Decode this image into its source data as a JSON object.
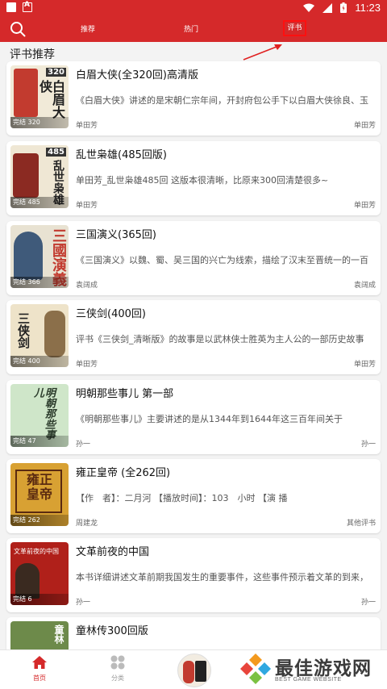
{
  "statusbar": {
    "time": "11:23"
  },
  "tabs": {
    "recommend": "推荐",
    "hot": "热门",
    "review": "评书"
  },
  "section": {
    "title": "评书推荐"
  },
  "books": [
    {
      "badge": "完结 320",
      "title": "白眉大侠(全320回)高清版",
      "desc": "《白眉大侠》讲述的是宋朝仁宗年间，开封府包公手下以白眉大侠徐良、玉",
      "author": "单田芳",
      "right": "单田芳",
      "cover_color": "#c23b2f",
      "cover_text": "白眉大侠",
      "cover_tag": "320"
    },
    {
      "badge": "完结 485",
      "title": "乱世枭雄(485回版)",
      "desc": "单田芳_乱世枭雄485回 这版本很清晰，比原来300回清楚很多~",
      "author": "单田芳",
      "right": "单田芳",
      "cover_color": "#8b2a22",
      "cover_text": "乱世枭雄",
      "cover_tag": "485"
    },
    {
      "badge": "完结 366",
      "title": "三国演义(365回)",
      "desc": "《三国演义》以魏、蜀、吴三国的兴亡为线索，描绘了汉末至晋统一的一百",
      "author": "袁阔成",
      "right": "袁阔成",
      "cover_color": "#3f5a7a",
      "cover_text": "三國演義",
      "cover_tag": ""
    },
    {
      "badge": "完结 400",
      "title": "三侠剑(400回)",
      "desc": "评书《三侠剑_清晰版》的故事是以武林侠士胜英为主人公的一部历史故事",
      "author": "单田芳",
      "right": "单田芳",
      "cover_color": "#e9dcc0",
      "cover_text": "三侠剑",
      "cover_tag": ""
    },
    {
      "badge": "完结 47",
      "title": "明朝那些事儿 第一部",
      "desc": "《明朝那些事儿》主要讲述的是从1344年到1644年这三百年间关于",
      "author": "孙一",
      "right": "孙一",
      "cover_color": "#cfe6c9",
      "cover_text": "明朝那些事儿",
      "cover_tag": ""
    },
    {
      "badge": "完结 262",
      "title": "雍正皇帝 (全262回)",
      "desc": "【作　者】：二月河 【播放时间】：103　小时 【演 播",
      "author": "周建龙",
      "right": "其他评书",
      "cover_color": "#d8a133",
      "cover_text": "雍正皇帝",
      "cover_tag": ""
    },
    {
      "badge": "完结 6",
      "title": "文革前夜的中国",
      "desc": "本书详细讲述文革前期我国发生的重要事件，这些事件预示着文革的到来，",
      "author": "孙一",
      "right": "孙一",
      "cover_color": "#b0201a",
      "cover_text": "文革前夜的中国",
      "cover_tag": ""
    },
    {
      "badge": "",
      "title": "童林传300回版",
      "desc": "",
      "author": "",
      "right": "",
      "cover_color": "#6d8a4a",
      "cover_text": "童林",
      "cover_tag": ""
    }
  ],
  "bottomnav": {
    "home": "首页",
    "category": "分类"
  },
  "watermark": {
    "name": "最佳游戏网",
    "sub": "BEST GAME WEBSITE"
  },
  "colors": {
    "primary": "#d5292a",
    "highlight_box": "#ff1010"
  }
}
